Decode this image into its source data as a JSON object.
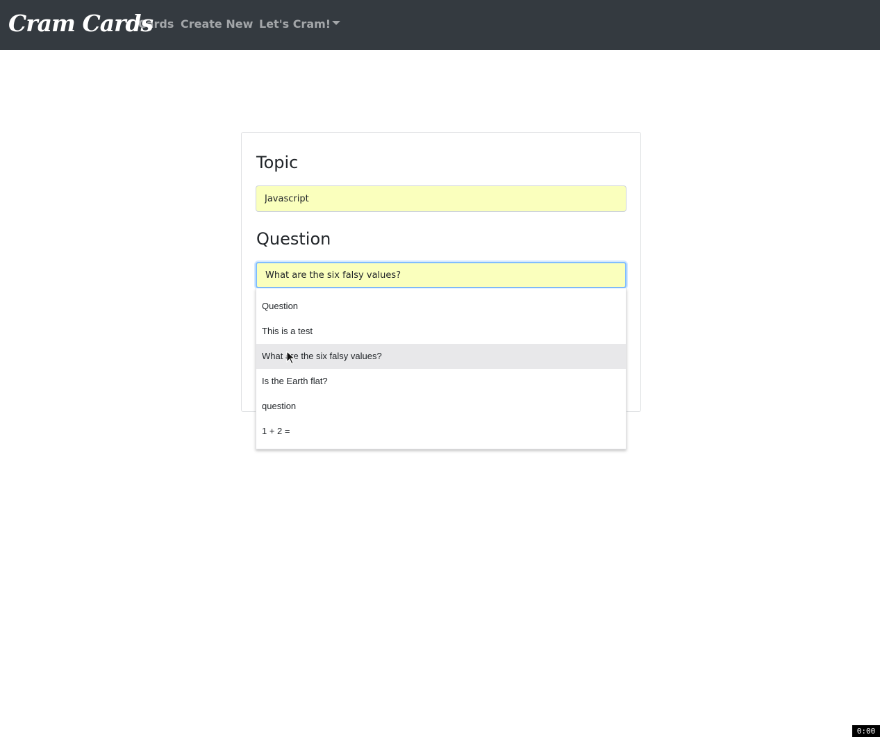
{
  "navbar": {
    "brand": "Cram Cards",
    "links": [
      {
        "label": "Cards"
      },
      {
        "label": "Create New"
      },
      {
        "label": "Let's Cram!"
      }
    ]
  },
  "form": {
    "topic_label": "Topic",
    "topic_value": "Javascript",
    "question_label": "Question",
    "question_value": "What are the six falsy values?"
  },
  "autocomplete": {
    "items": [
      "Question",
      "This is a test",
      "What are the six falsy values?",
      "Is the Earth flat?",
      "question",
      "1 + 2 ="
    ],
    "highlighted_index": 2
  },
  "recording_timer": "0:00",
  "colors": {
    "navbar_bg": "#343a40",
    "field_autofill_bg": "#faffbd",
    "focus_border": "#80bdff",
    "highlight_bg": "#e8e8ea"
  }
}
